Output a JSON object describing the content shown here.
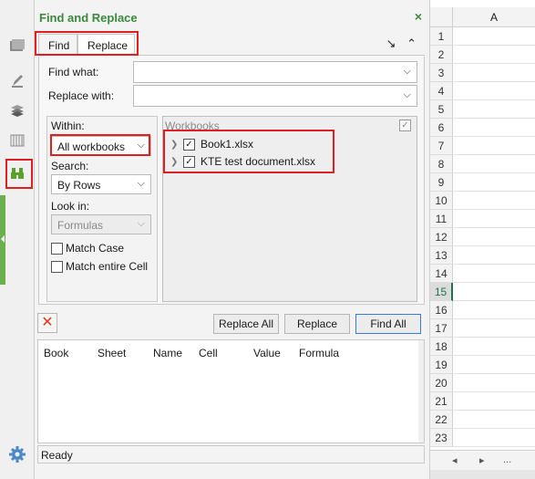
{
  "panel": {
    "title": "Find and Replace",
    "close_glyph": "×",
    "tabs": [
      {
        "label": "Find",
        "active": false
      },
      {
        "label": "Replace",
        "active": true
      }
    ],
    "tools": {
      "expand_glyph": "↘",
      "collapse_glyph": "⌃"
    }
  },
  "form": {
    "find_what_label": "Find what:",
    "find_what_value": "",
    "replace_with_label": "Replace with:",
    "replace_with_value": "",
    "within_label": "Within:",
    "within_value": "All workbooks",
    "search_label": "Search:",
    "search_value": "By Rows",
    "lookin_label": "Look in:",
    "lookin_value": "Formulas",
    "match_case_label": "Match Case",
    "match_case_checked": false,
    "match_cell_label": "Match entire Cell",
    "match_cell_checked": false
  },
  "workbooks": {
    "header": "Workbooks",
    "items": [
      {
        "name": "Book1.xlsx",
        "checked": true
      },
      {
        "name": "KTE test document.xlsx",
        "checked": true
      }
    ]
  },
  "buttons": {
    "replace_all": "Replace All",
    "replace": "Replace",
    "find_all": "Find All"
  },
  "results": {
    "columns": [
      "Book",
      "Sheet",
      "Name",
      "Cell",
      "Value",
      "Formula"
    ]
  },
  "status": {
    "text": "Ready"
  },
  "sheet": {
    "column_header": "A",
    "rows": [
      "1",
      "2",
      "3",
      "4",
      "5",
      "6",
      "7",
      "8",
      "9",
      "10",
      "11",
      "12",
      "13",
      "14",
      "15",
      "16",
      "17",
      "18",
      "19",
      "20",
      "21",
      "22",
      "23"
    ],
    "selected_row": "15",
    "nav_prev": "◂",
    "nav_next": "▸",
    "nav_more": "..."
  },
  "colors": {
    "title_green": "#3a8a3a",
    "highlight_red": "#e02020",
    "excel_green": "#217346",
    "primary_border": "#3a7bd5"
  }
}
